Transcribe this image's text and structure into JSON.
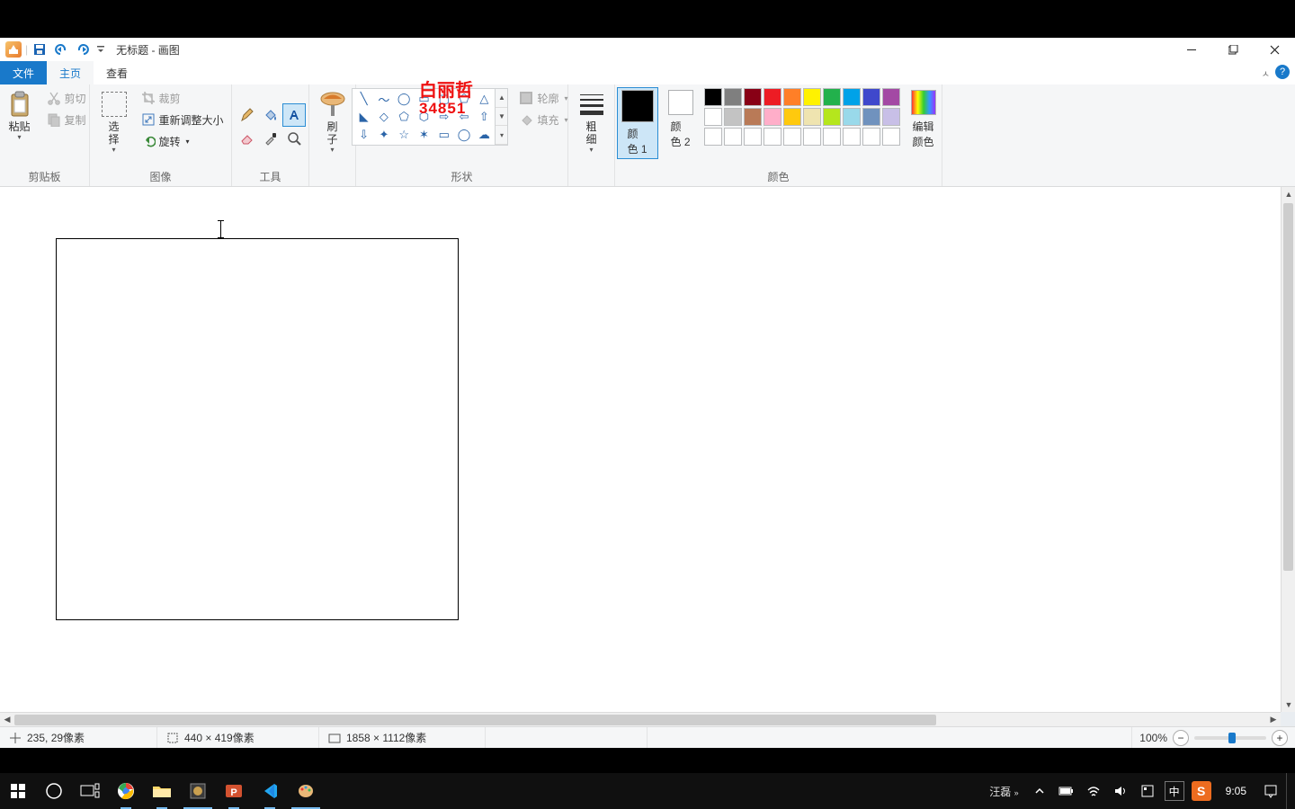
{
  "title": "无标题 - 画图",
  "watermark": {
    "line1": "白丽哲",
    "line2": "34851"
  },
  "tabs": {
    "file": "文件",
    "home": "主页",
    "view": "查看"
  },
  "ribbon": {
    "clipboard": {
      "label": "剪贴板",
      "paste": "粘贴",
      "cut": "剪切",
      "copy": "复制"
    },
    "image": {
      "label": "图像",
      "select": "选\n择",
      "crop": "裁剪",
      "resize": "重新调整大小",
      "rotate": "旋转"
    },
    "tools": {
      "label": "工具"
    },
    "brushes": {
      "label": "刷\n子"
    },
    "shapes": {
      "label": "形状",
      "outline": "轮廓",
      "fill": "填充"
    },
    "size": {
      "label": "粗\n细"
    },
    "colors": {
      "label": "颜色",
      "color1": "颜\n色 1",
      "color2": "颜\n色 2",
      "edit": "编辑\n颜色",
      "color1_value": "#000000",
      "color2_value": "#ffffff",
      "palette_row1": [
        "#000000",
        "#7f7f7f",
        "#880015",
        "#ed1c24",
        "#ff7f27",
        "#fff200",
        "#22b14c",
        "#00a2e8",
        "#3f48cc",
        "#a349a4"
      ],
      "palette_row2": [
        "#ffffff",
        "#c3c3c3",
        "#b97a57",
        "#ffaec9",
        "#ffc90e",
        "#efe4b0",
        "#b5e61d",
        "#99d9ea",
        "#7092be",
        "#c8bfe7"
      ],
      "palette_row3": [
        "#ffffff",
        "#ffffff",
        "#ffffff",
        "#ffffff",
        "#ffffff",
        "#ffffff",
        "#ffffff",
        "#ffffff",
        "#ffffff",
        "#ffffff"
      ]
    }
  },
  "status": {
    "cursor_pos": "235, 29像素",
    "selection_size": "440 × 419像素",
    "canvas_size": "1858 × 1112像素",
    "zoom": "100%",
    "zoom_value": 100
  },
  "taskbar": {
    "tray_label": "汪磊",
    "ime_lang": "中",
    "sogou": "S",
    "clock": "9:05"
  }
}
